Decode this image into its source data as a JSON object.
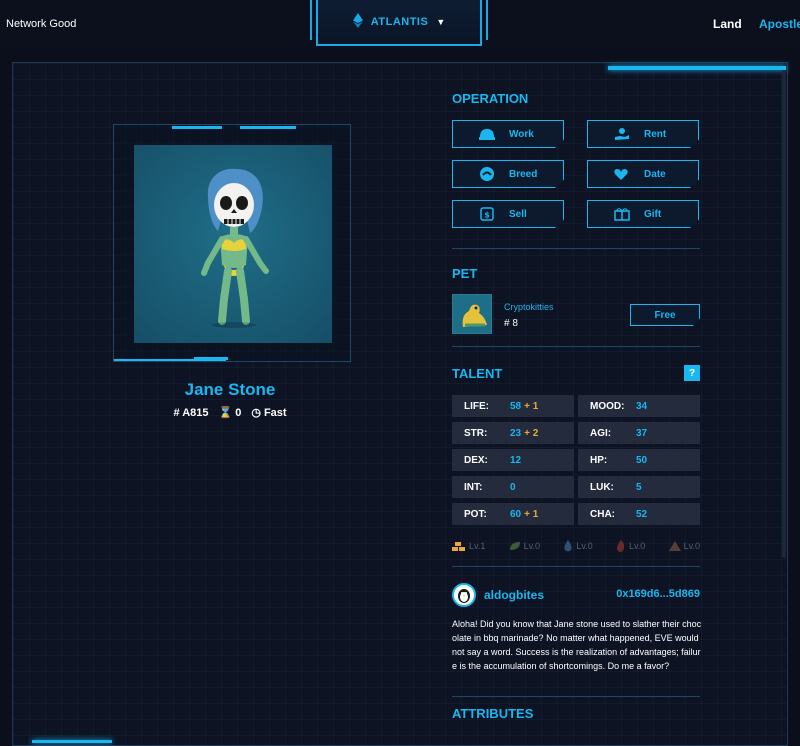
{
  "header": {
    "network_status": "Network Good",
    "world": "ATLANTIS",
    "nav": {
      "land": "Land",
      "apostle": "Apostle"
    }
  },
  "apostle": {
    "name": "Jane Stone",
    "id": "# A815",
    "cooldown_count": "0",
    "speed": "Fast"
  },
  "operation": {
    "title": "OPERATION",
    "buttons": [
      {
        "label": "Work",
        "icon": "helmet-icon"
      },
      {
        "label": "Rent",
        "icon": "hand-coin-icon"
      },
      {
        "label": "Breed",
        "icon": "breed-icon"
      },
      {
        "label": "Date",
        "icon": "hearts-icon"
      },
      {
        "label": "Sell",
        "icon": "sell-icon"
      },
      {
        "label": "Gift",
        "icon": "gift-icon"
      }
    ]
  },
  "pet": {
    "title": "PET",
    "name": "Cryptokitties",
    "id": "# 8",
    "action": "Free"
  },
  "talent": {
    "title": "TALENT",
    "help": "?",
    "stats": [
      {
        "key": "LIFE:",
        "value": "58",
        "bonus": "+ 1"
      },
      {
        "key": "MOOD:",
        "value": "34",
        "bonus": ""
      },
      {
        "key": "STR:",
        "value": "23",
        "bonus": "+ 2"
      },
      {
        "key": "AGI:",
        "value": "37",
        "bonus": ""
      },
      {
        "key": "DEX:",
        "value": "12",
        "bonus": ""
      },
      {
        "key": "HP:",
        "value": "50",
        "bonus": ""
      },
      {
        "key": "INT:",
        "value": "0",
        "bonus": ""
      },
      {
        "key": "LUK:",
        "value": "5",
        "bonus": ""
      },
      {
        "key": "POT:",
        "value": "60",
        "bonus": "+ 1"
      },
      {
        "key": "CHA:",
        "value": "52",
        "bonus": ""
      }
    ],
    "levels": [
      {
        "label": "Lv.1",
        "icon": "gold-bars-icon",
        "active": true
      },
      {
        "label": "Lv.0",
        "icon": "leaf-icon",
        "active": false
      },
      {
        "label": "Lv.0",
        "icon": "water-drop-icon",
        "active": false
      },
      {
        "label": "Lv.0",
        "icon": "fire-icon",
        "active": false
      },
      {
        "label": "Lv.0",
        "icon": "mountain-icon",
        "active": false
      }
    ]
  },
  "owner": {
    "name": "aldogbites",
    "address": "0x169d6...5d869",
    "story": "Aloha! Did you know that Jane stone used to slather their chocolate in bbq marinade? No matter what happened, EVE would not say a word. Success is the realization of advantages; failure is the accumulation of shortcomings. Do me a favor?"
  },
  "attributes": {
    "title": "ATTRIBUTES"
  },
  "colors": {
    "accent": "#1ab6f0",
    "bonus": "#e8a83a",
    "background": "#0b0f1c"
  }
}
